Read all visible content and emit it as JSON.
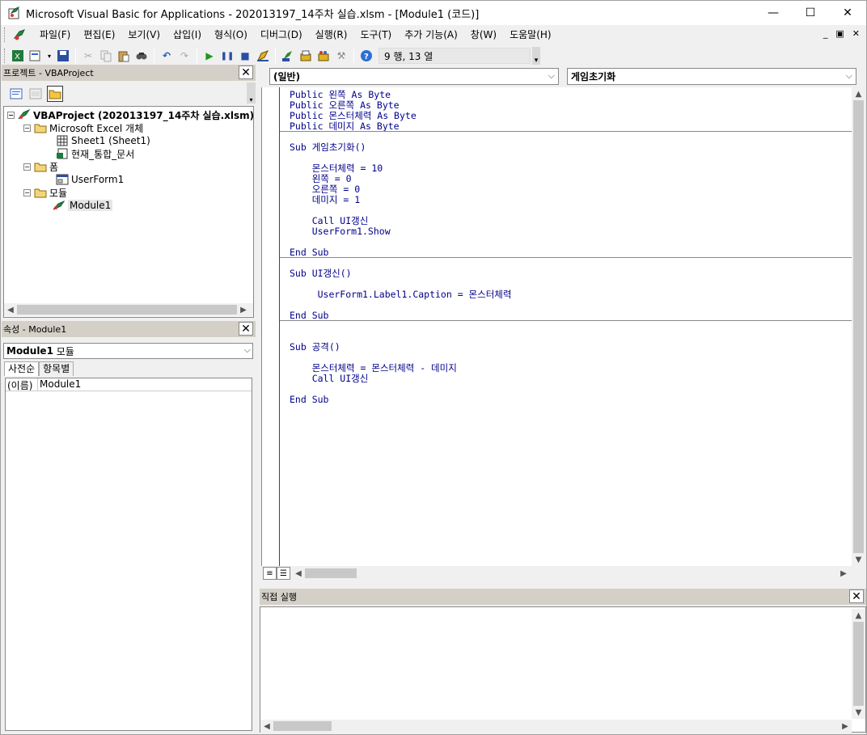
{
  "window": {
    "title": "Microsoft Visual Basic for Applications - 202013197_14주차 실습.xlsm - [Module1 (코드)]",
    "minimize": "—",
    "maximize": "☐",
    "close": "✕"
  },
  "menu": {
    "items": [
      "파일(F)",
      "편집(E)",
      "보기(V)",
      "삽입(I)",
      "형식(O)",
      "디버그(D)",
      "실행(R)",
      "도구(T)",
      "추가 기능(A)",
      "창(W)",
      "도움말(H)"
    ],
    "mdi_minimize": "_",
    "mdi_restore": "▣",
    "mdi_close": "✕"
  },
  "toolbar": {
    "position": "9 행, 13 열",
    "icons": [
      "excel-icon",
      "insert-module-icon",
      "save-icon",
      "cut-icon",
      "copy-icon",
      "paste-icon",
      "find-icon",
      "undo-icon",
      "redo-icon",
      "run-icon",
      "break-icon",
      "reset-icon",
      "design-mode-icon",
      "project-explorer-icon",
      "properties-icon",
      "object-browser-icon",
      "toolbox-icon",
      "help-icon"
    ]
  },
  "project": {
    "header": "프로젝트 - VBAProject",
    "tree": [
      {
        "label": "VBAProject (202013197_14주차 실습.xlsm)",
        "level": 0,
        "bold": true,
        "icon": "vba-project-icon",
        "expander": "−"
      },
      {
        "label": "Microsoft Excel 개체",
        "level": 1,
        "icon": "folder-open-icon",
        "expander": "−"
      },
      {
        "label": "Sheet1 (Sheet1)",
        "level": 2,
        "icon": "sheet-icon"
      },
      {
        "label": "현재_통합_문서",
        "level": 2,
        "icon": "workbook-icon"
      },
      {
        "label": "폼",
        "level": 1,
        "icon": "folder-open-icon",
        "expander": "−"
      },
      {
        "label": "UserForm1",
        "level": 2,
        "icon": "userform-icon"
      },
      {
        "label": "모듈",
        "level": 1,
        "icon": "folder-open-icon",
        "expander": "−"
      },
      {
        "label": "Module1",
        "level": 2,
        "icon": "module-icon",
        "selected": true
      }
    ]
  },
  "properties": {
    "header": "속성 - Module1",
    "combo_name": "Module1",
    "combo_type": "모듈",
    "tabs": [
      "사전순",
      "항목별"
    ],
    "rows": [
      {
        "name": "(이름)",
        "value": "Module1"
      }
    ]
  },
  "code": {
    "object_combo": "(일반)",
    "procedure_combo": "게임초기화",
    "lines": [
      "Public 왼쪽 As Byte",
      "Public 오른쪽 As Byte",
      "Public 몬스터체력 As Byte",
      "Public 데미지 As Byte",
      "Sub 게임초기화()",
      "    몬스터체력 = 10",
      "    왼쪽 = 0",
      "    오른쪽 = 0",
      "    데미지 = 1",
      "    Call UI갱신",
      "    UserForm1.Show",
      "End Sub",
      "Sub UI갱신()",
      "     UserForm1.Label1.Caption = 몬스터체력",
      "End Sub",
      "Sub 공격()",
      "    몬스터체력 = 몬스터체력 - 데미지",
      "    Call UI갱신",
      "End Sub"
    ]
  },
  "immediate": {
    "header": "직접 실행"
  }
}
